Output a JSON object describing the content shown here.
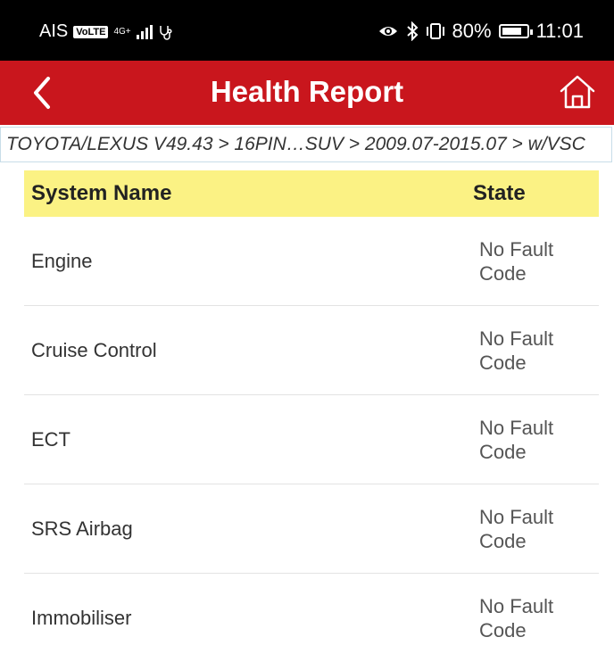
{
  "status_bar": {
    "carrier": "AIS",
    "volte": "VoLTE",
    "network": "4G+",
    "battery": "80%",
    "battery_fraction": 0.8,
    "time": "11:01"
  },
  "app_bar": {
    "title": "Health Report",
    "back_icon": "chevron-left-icon",
    "home_icon": "home-icon",
    "color": "#c9161d"
  },
  "breadcrumb": "TOYOTA/LEXUS V49.43 > 16PIN…SUV > 2009.07-2015.07 > w/VSC",
  "table": {
    "header_color": "#fbf284",
    "columns": [
      "System Name",
      "State"
    ],
    "rows": [
      {
        "name": "Engine",
        "state_line1": "No Fault",
        "state_line2": "Code"
      },
      {
        "name": "Cruise Control",
        "state_line1": "No Fault",
        "state_line2": "Code"
      },
      {
        "name": "ECT",
        "state_line1": "No Fault",
        "state_line2": "Code"
      },
      {
        "name": "SRS Airbag",
        "state_line1": "No Fault",
        "state_line2": "Code"
      },
      {
        "name": "Immobiliser",
        "state_line1": "No Fault",
        "state_line2": "Code"
      }
    ]
  }
}
